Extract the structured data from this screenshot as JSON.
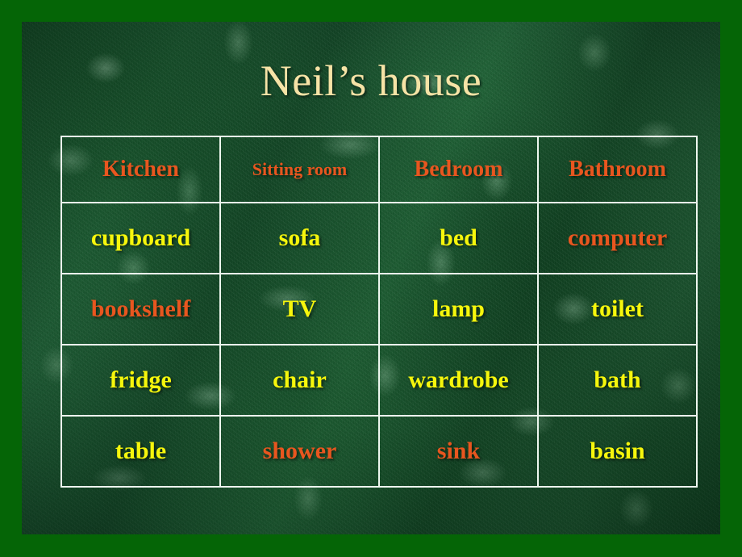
{
  "slide": {
    "title": "Neil’s house",
    "border_color": "#056506",
    "background_color": "#1d5a32",
    "title_color": "#f6e3a6",
    "grid_line_color": "#eef7ef",
    "header_color": "#e8561f",
    "word_yellow": "#f6f60c",
    "word_orange": "#e8561f"
  },
  "table": {
    "headers": [
      {
        "label": "Kitchen",
        "color": "#e8561f",
        "size": "normal"
      },
      {
        "label": "Sitting room",
        "color": "#e8561f",
        "size": "small"
      },
      {
        "label": "Bedroom",
        "color": "#e8561f",
        "size": "normal"
      },
      {
        "label": "Bathroom",
        "color": "#e8561f",
        "size": "normal"
      }
    ],
    "rows": [
      [
        {
          "label": "cupboard",
          "color": "yellow"
        },
        {
          "label": "sofa",
          "color": "yellow"
        },
        {
          "label": "bed",
          "color": "yellow"
        },
        {
          "label": "computer",
          "color": "orange"
        }
      ],
      [
        {
          "label": "bookshelf",
          "color": "orange"
        },
        {
          "label": "TV",
          "color": "yellow"
        },
        {
          "label": "lamp",
          "color": "yellow"
        },
        {
          "label": "toilet",
          "color": "yellow"
        }
      ],
      [
        {
          "label": "fridge",
          "color": "yellow"
        },
        {
          "label": "chair",
          "color": "yellow"
        },
        {
          "label": "wardrobe",
          "color": "yellow"
        },
        {
          "label": "bath",
          "color": "yellow"
        }
      ],
      [
        {
          "label": "table",
          "color": "yellow"
        },
        {
          "label": "shower",
          "color": "orange"
        },
        {
          "label": "sink",
          "color": "orange"
        },
        {
          "label": "basin",
          "color": "yellow"
        }
      ]
    ]
  }
}
